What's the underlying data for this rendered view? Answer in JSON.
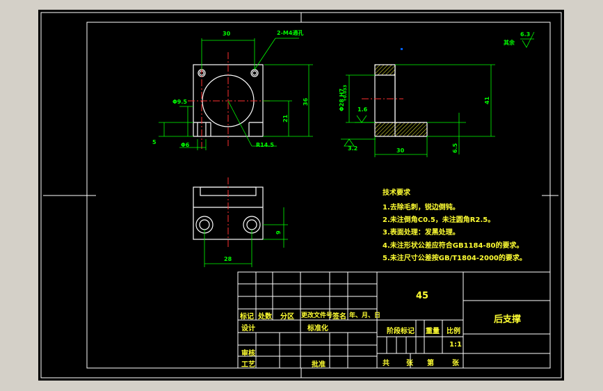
{
  "colors": {
    "background": "#d4d0c8",
    "sheet": "#000000",
    "border": "#ffffff",
    "outline": "#ffffff",
    "dimension": "#00ff00",
    "text": "#ffff33",
    "centerline": "#ff3030",
    "section": "#ffff33",
    "accent": "#0060ff"
  },
  "dimensions": {
    "top_width": "30",
    "holes_note": "2-M4通孔",
    "dia_small": "Φ9.5",
    "dim_5": "5",
    "dia_6": "Φ6",
    "radius": "R14.5",
    "height_21": "21",
    "height_36": "36",
    "roughness_side": "1.6",
    "bore_dia": "Φ28 H7",
    "bore_tol": "+0.033",
    "height_41": "41",
    "roughness_bottom": "3.2",
    "width_30": "30",
    "dim_6_5": "6.5",
    "width_28": "28",
    "dim_9": "9",
    "roughness_general_value": "6.3",
    "roughness_general_label": "其余"
  },
  "tech_requirements": {
    "title": "技术要求",
    "items": [
      "1.去除毛刺，锐边倒钝。",
      "2.未注倒角C0.5，未注圆角R2.5。",
      "3.表面处理：发黑处理。",
      "4.未注形状公差应符合GB1184-80的要求。",
      "5.未注尺寸公差按GB/T1804-2000的要求。"
    ]
  },
  "title_block": {
    "material": "45",
    "part_name": "后支撑",
    "headers": {
      "mark": "标记",
      "count": "处数",
      "zone": "分区",
      "change_doc": "更改文件号",
      "signature": "签名",
      "date": "年、月、日"
    },
    "design": "设计",
    "standardization": "标准化",
    "check": "审核",
    "process": "工艺",
    "approve": "批准",
    "stage_mark": "阶段标记",
    "weight": "重量",
    "scale_label": "比例",
    "scale_value": "1:1",
    "total": "共",
    "sheet_unit": "张",
    "page_label": "第",
    "page_unit": "张"
  }
}
